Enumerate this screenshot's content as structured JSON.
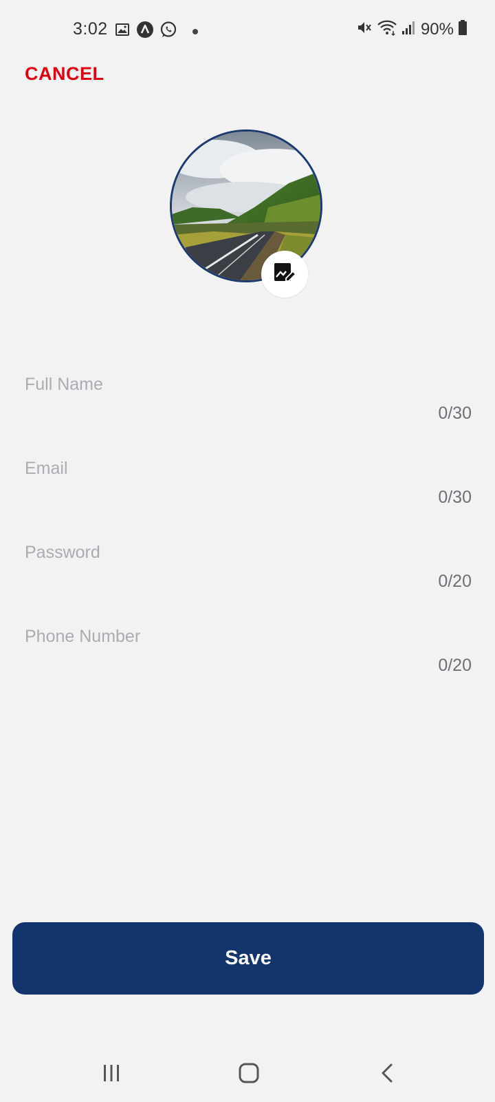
{
  "status_bar": {
    "time": "3:02",
    "battery": "90%",
    "icons_left": [
      "gallery-icon",
      "app-icon",
      "whatsapp-icon",
      "notification-dot"
    ],
    "icons_right": [
      "mute-icon",
      "wifi-icon",
      "signal-icon",
      "battery-icon"
    ]
  },
  "header": {
    "cancel_label": "CANCEL"
  },
  "profile": {
    "avatar_icon": "landscape-photo",
    "edit_icon": "edit-photo-icon"
  },
  "form": {
    "fields": [
      {
        "placeholder": "Full Name",
        "value": "",
        "counter": "0/30"
      },
      {
        "placeholder": "Email",
        "value": "",
        "counter": "0/30"
      },
      {
        "placeholder": "Password",
        "value": "",
        "counter": "0/20"
      },
      {
        "placeholder": "Phone Number",
        "value": "",
        "counter": "0/20"
      }
    ]
  },
  "actions": {
    "save_label": "Save"
  },
  "colors": {
    "background": "#f2f2f2",
    "cancel": "#e00012",
    "primary": "#13346c",
    "placeholder": "#a9acb2",
    "counter": "#6c6f75"
  }
}
